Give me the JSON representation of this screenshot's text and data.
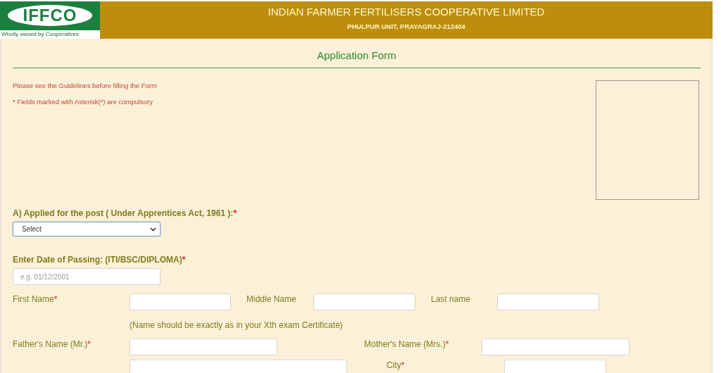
{
  "header": {
    "logo_text": "IFFCO",
    "logo_tagline": "Wholly owned by Cooperatives",
    "title": "INDIAN FARMER FERTILISERS COOPERATIVE LIMITED",
    "subtitle": "PHULPUR UNIT, PRAYAGRAJ-212404"
  },
  "form": {
    "title": "Application Form",
    "notes": [
      "Please see the Guidelines before filling the Form",
      "* Fields marked with Asterisk(*) are compulsory"
    ],
    "post": {
      "label": "A) Applied for the post ( Under Apprentices Act, 1961 ):",
      "mark": "*",
      "value": "Select"
    },
    "passing_date": {
      "label": "Enter Date of Passing: (ITI/BSC/DIPLOMA)",
      "mark": "*",
      "placeholder": "e.g. 01/12/2001"
    },
    "name_row": [
      {
        "label": "First Name",
        "mark": "*"
      },
      {
        "label": "Middle Name"
      },
      {
        "label": "Last name"
      }
    ],
    "name_note": "(Name should be exactly as in your Xth exam Certificate)",
    "parent_row": [
      {
        "label": "Father's Name (Mr.)",
        "mark": "*"
      },
      {
        "label": "Mother's Name (Mrs.)",
        "mark": "*"
      }
    ],
    "address_row": [
      {
        "label": "City",
        "mark": "*"
      }
    ]
  }
}
